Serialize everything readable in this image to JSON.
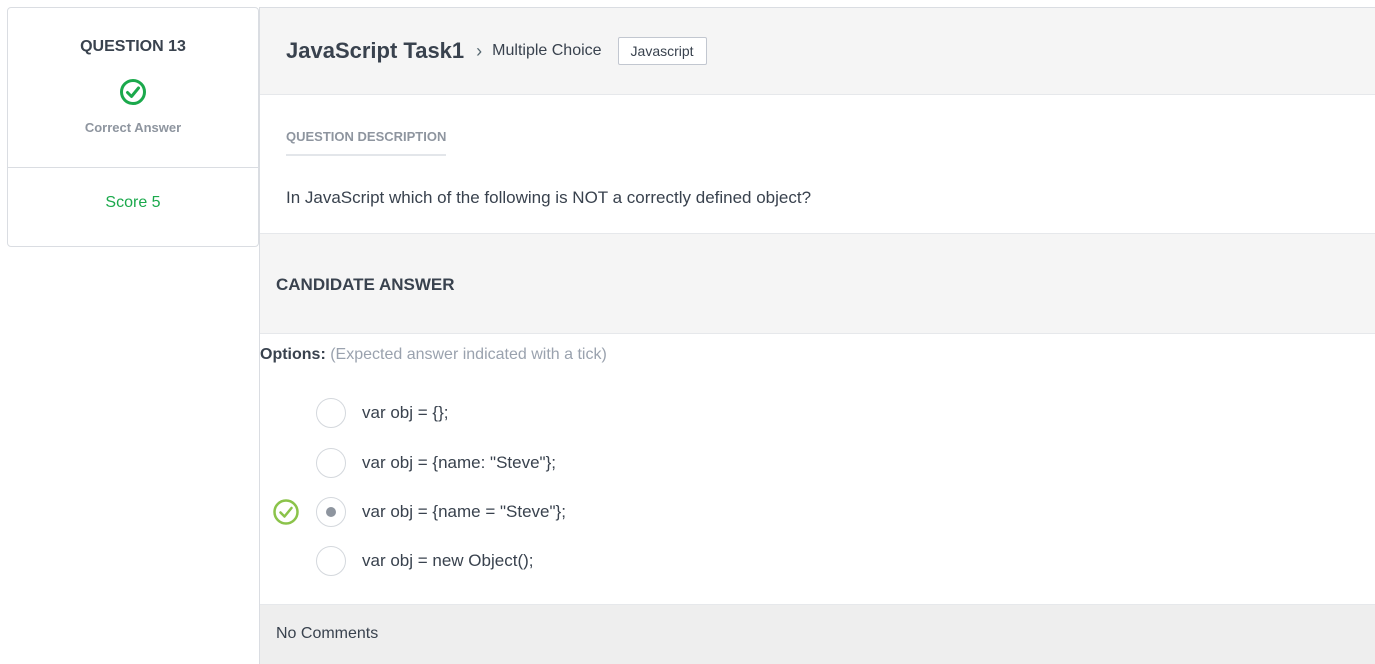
{
  "sidebar": {
    "question_label": "QUESTION 13",
    "status_icon": "check-circle-icon",
    "status_text": "Correct Answer",
    "score_text": "Score 5",
    "accent_color": "#1ba94c"
  },
  "header": {
    "task_title": "JavaScript Task1",
    "separator": "›",
    "question_type": "Multiple Choice",
    "language_badge": "Javascript"
  },
  "description": {
    "heading": "QUESTION DESCRIPTION",
    "text": "In JavaScript which of the following is NOT a correctly defined object?"
  },
  "candidate": {
    "heading": "CANDIDATE ANSWER",
    "options_label": "Options:",
    "options_hint": "(Expected answer indicated with a tick)",
    "options": [
      {
        "text": "var obj = {};",
        "selected": false,
        "expected": false
      },
      {
        "text": "var obj = {name: \"Steve\"};",
        "selected": false,
        "expected": false
      },
      {
        "text": "var obj = {name = \"Steve\"};",
        "selected": true,
        "expected": true
      },
      {
        "text": "var obj = new Object();",
        "selected": false,
        "expected": false
      }
    ]
  },
  "comments": {
    "text": "No Comments"
  }
}
